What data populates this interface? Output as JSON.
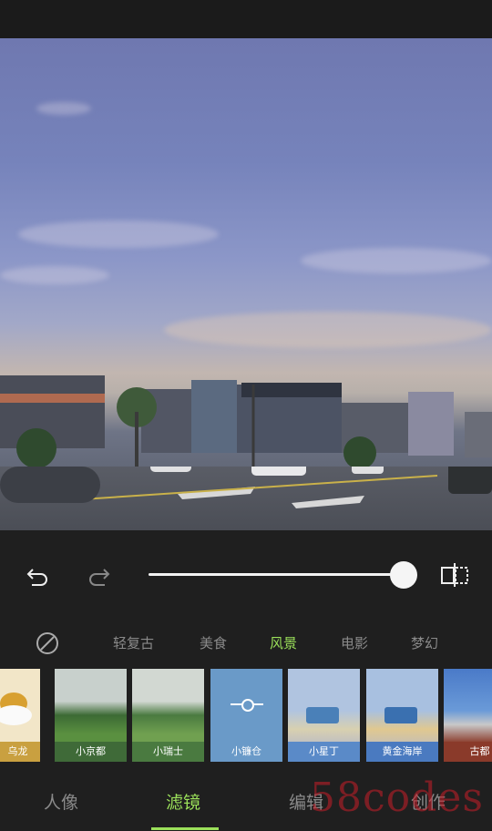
{
  "photo": {
    "description_icon": "street-photo"
  },
  "controls": {
    "undo_icon": "undo-icon",
    "redo_icon": "redo-icon",
    "compare_icon": "compare-icon",
    "intensity_percent": 100
  },
  "categories": [
    {
      "label": "",
      "icon": "no-filter-icon"
    },
    {
      "label": "轻复古"
    },
    {
      "label": "美食"
    },
    {
      "label": "风景",
      "active": true
    },
    {
      "label": "电影"
    },
    {
      "label": "梦幻"
    }
  ],
  "filters": [
    {
      "label": "乌龙"
    },
    {
      "label": "小京都"
    },
    {
      "label": "小瑞士"
    },
    {
      "label": "小镰仓",
      "selected": true
    },
    {
      "label": "小星丁"
    },
    {
      "label": "黄金海岸"
    },
    {
      "label": "古都"
    }
  ],
  "nav": {
    "items": [
      "人像",
      "滤镜",
      "编辑",
      "创作"
    ],
    "active_index": 1
  },
  "watermark": "58codes",
  "colors": {
    "accent": "#9be05a",
    "background": "#1f1f1f"
  }
}
